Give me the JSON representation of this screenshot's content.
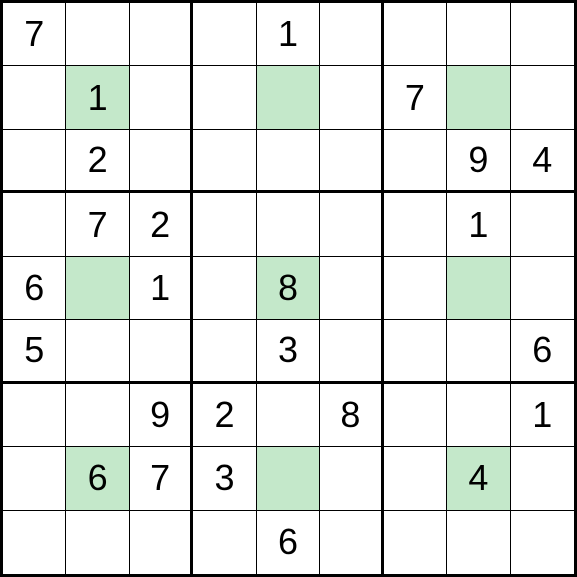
{
  "sudoku": {
    "rows": [
      [
        {
          "v": "7",
          "h": false
        },
        {
          "v": "",
          "h": false
        },
        {
          "v": "",
          "h": false
        },
        {
          "v": "",
          "h": false
        },
        {
          "v": "1",
          "h": false
        },
        {
          "v": "",
          "h": false
        },
        {
          "v": "",
          "h": false
        },
        {
          "v": "",
          "h": false
        },
        {
          "v": "",
          "h": false
        }
      ],
      [
        {
          "v": "",
          "h": false
        },
        {
          "v": "1",
          "h": true
        },
        {
          "v": "",
          "h": false
        },
        {
          "v": "",
          "h": false
        },
        {
          "v": "",
          "h": true
        },
        {
          "v": "",
          "h": false
        },
        {
          "v": "7",
          "h": false
        },
        {
          "v": "",
          "h": true
        },
        {
          "v": "",
          "h": false
        }
      ],
      [
        {
          "v": "",
          "h": false
        },
        {
          "v": "2",
          "h": false
        },
        {
          "v": "",
          "h": false
        },
        {
          "v": "",
          "h": false
        },
        {
          "v": "",
          "h": false
        },
        {
          "v": "",
          "h": false
        },
        {
          "v": "",
          "h": false
        },
        {
          "v": "9",
          "h": false
        },
        {
          "v": "4",
          "h": false
        }
      ],
      [
        {
          "v": "",
          "h": false
        },
        {
          "v": "7",
          "h": false
        },
        {
          "v": "2",
          "h": false
        },
        {
          "v": "",
          "h": false
        },
        {
          "v": "",
          "h": false
        },
        {
          "v": "",
          "h": false
        },
        {
          "v": "",
          "h": false
        },
        {
          "v": "1",
          "h": false
        },
        {
          "v": "",
          "h": false
        }
      ],
      [
        {
          "v": "6",
          "h": false
        },
        {
          "v": "",
          "h": true
        },
        {
          "v": "1",
          "h": false
        },
        {
          "v": "",
          "h": false
        },
        {
          "v": "8",
          "h": true
        },
        {
          "v": "",
          "h": false
        },
        {
          "v": "",
          "h": false
        },
        {
          "v": "",
          "h": true
        },
        {
          "v": "",
          "h": false
        }
      ],
      [
        {
          "v": "5",
          "h": false
        },
        {
          "v": "",
          "h": false
        },
        {
          "v": "",
          "h": false
        },
        {
          "v": "",
          "h": false
        },
        {
          "v": "3",
          "h": false
        },
        {
          "v": "",
          "h": false
        },
        {
          "v": "",
          "h": false
        },
        {
          "v": "",
          "h": false
        },
        {
          "v": "6",
          "h": false
        }
      ],
      [
        {
          "v": "",
          "h": false
        },
        {
          "v": "",
          "h": false
        },
        {
          "v": "9",
          "h": false
        },
        {
          "v": "2",
          "h": false
        },
        {
          "v": "",
          "h": false
        },
        {
          "v": "8",
          "h": false
        },
        {
          "v": "",
          "h": false
        },
        {
          "v": "",
          "h": false
        },
        {
          "v": "1",
          "h": false
        }
      ],
      [
        {
          "v": "",
          "h": false
        },
        {
          "v": "6",
          "h": true
        },
        {
          "v": "7",
          "h": false
        },
        {
          "v": "3",
          "h": false
        },
        {
          "v": "",
          "h": true
        },
        {
          "v": "",
          "h": false
        },
        {
          "v": "",
          "h": false
        },
        {
          "v": "4",
          "h": true
        },
        {
          "v": "",
          "h": false
        }
      ],
      [
        {
          "v": "",
          "h": false
        },
        {
          "v": "",
          "h": false
        },
        {
          "v": "",
          "h": false
        },
        {
          "v": "",
          "h": false
        },
        {
          "v": "6",
          "h": false
        },
        {
          "v": "",
          "h": false
        },
        {
          "v": "",
          "h": false
        },
        {
          "v": "",
          "h": false
        },
        {
          "v": "",
          "h": false
        }
      ]
    ]
  },
  "colors": {
    "highlight": "#c4e8ca",
    "grid_line": "#000000",
    "cell_bg": "#ffffff"
  }
}
